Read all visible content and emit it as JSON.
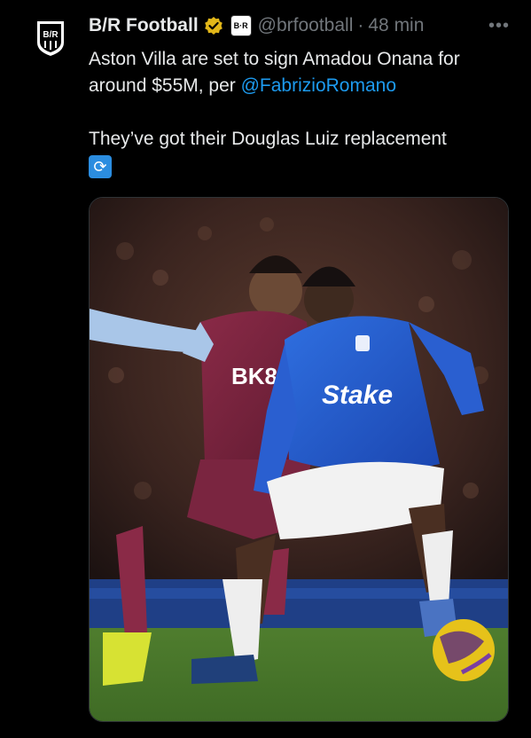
{
  "tweet": {
    "author_name": "B/R Football",
    "affiliate_badge": "B·R",
    "handle": "@brfootball",
    "separator": "·",
    "time": "48 min",
    "more_icon": "•••",
    "text_line1": "Aston Villa are set to sign Amadou Onana for around $55M, per ",
    "mention": "@FabrizioRomano",
    "text_line2": "They’ve got their Douglas Luiz replacement",
    "emoji": "🔄"
  },
  "media": {
    "alt": "Football match photo: Everton player in blue Stake kit shielding the ball from Aston Villa player in claret BK8 kit",
    "shirt_text_villa": "BK8",
    "shirt_text_everton": "Stake"
  },
  "colors": {
    "background": "#000000",
    "text": "#e7e9ea",
    "muted": "#71767b",
    "link": "#1d9bf0",
    "verified_gold": "#e2b719"
  }
}
